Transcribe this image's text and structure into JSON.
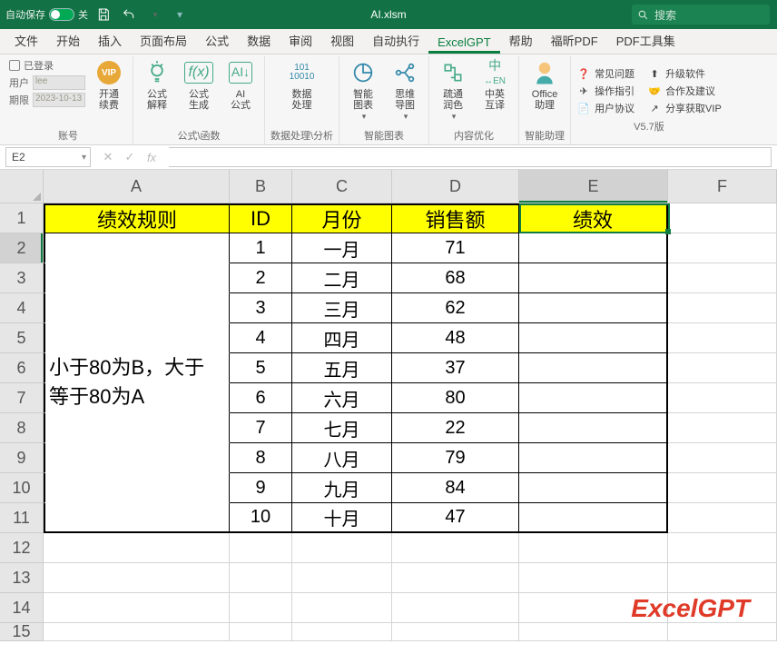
{
  "title": {
    "autosave": "自动保存",
    "toggle_state": "关",
    "filename": "AI.xlsm",
    "search_placeholder": "搜索"
  },
  "tabs": [
    "文件",
    "开始",
    "插入",
    "页面布局",
    "公式",
    "数据",
    "审阅",
    "视图",
    "自动执行",
    "ExcelGPT",
    "帮助",
    "福昕PDF",
    "PDF工具集"
  ],
  "active_tab": "ExcelGPT",
  "ribbon": {
    "account": {
      "login": "已登录",
      "user_lbl": "用户",
      "user_val": "lee",
      "date_lbl": "期限",
      "date_val": "2023-10-13",
      "vip": "开通\n续费",
      "group": "账号"
    },
    "formula": {
      "b1": "公式\n解释",
      "b2": "公式\n生成",
      "b3": "AI\n公式",
      "group": "公式\\函数"
    },
    "data": {
      "b1": "数据\n处理",
      "group": "数据处理\\分析"
    },
    "chart": {
      "b1": "智能\n图表",
      "b2": "思维\n导图",
      "group": "智能图表"
    },
    "content": {
      "b1": "疏通\n润色",
      "b2": "中英\n互译",
      "group": "内容优化"
    },
    "assist": {
      "b1": "Office\n助理",
      "group": "智能助理"
    },
    "version": {
      "faq": "常见问题",
      "guide": "操作指引",
      "user": "用户协议",
      "upgrade": "升级软件",
      "coop": "合作及建议",
      "share": "分享获取VIP",
      "group": "V5.7版"
    }
  },
  "namebox": "E2",
  "chart_data": {
    "type": "table",
    "headers": {
      "A": "绩效规则",
      "B": "ID",
      "C": "月份",
      "D": "销售额",
      "E": "绩效"
    },
    "rule_text": "小于80为B，大于等于80为A",
    "rows": [
      {
        "id": "1",
        "month": "一月",
        "sales": "71"
      },
      {
        "id": "2",
        "month": "二月",
        "sales": "68"
      },
      {
        "id": "3",
        "month": "三月",
        "sales": "62"
      },
      {
        "id": "4",
        "month": "四月",
        "sales": "48"
      },
      {
        "id": "5",
        "month": "五月",
        "sales": "37"
      },
      {
        "id": "6",
        "month": "六月",
        "sales": "80"
      },
      {
        "id": "7",
        "month": "七月",
        "sales": "22"
      },
      {
        "id": "8",
        "month": "八月",
        "sales": "79"
      },
      {
        "id": "9",
        "month": "九月",
        "sales": "84"
      },
      {
        "id": "10",
        "month": "十月",
        "sales": "47"
      }
    ]
  },
  "col_letters": [
    "A",
    "B",
    "C",
    "D",
    "E",
    "F"
  ],
  "row_numbers": [
    "1",
    "2",
    "3",
    "4",
    "5",
    "6",
    "7",
    "8",
    "9",
    "10",
    "11",
    "12",
    "13",
    "14",
    "15"
  ],
  "watermark": "ExcelGPT"
}
